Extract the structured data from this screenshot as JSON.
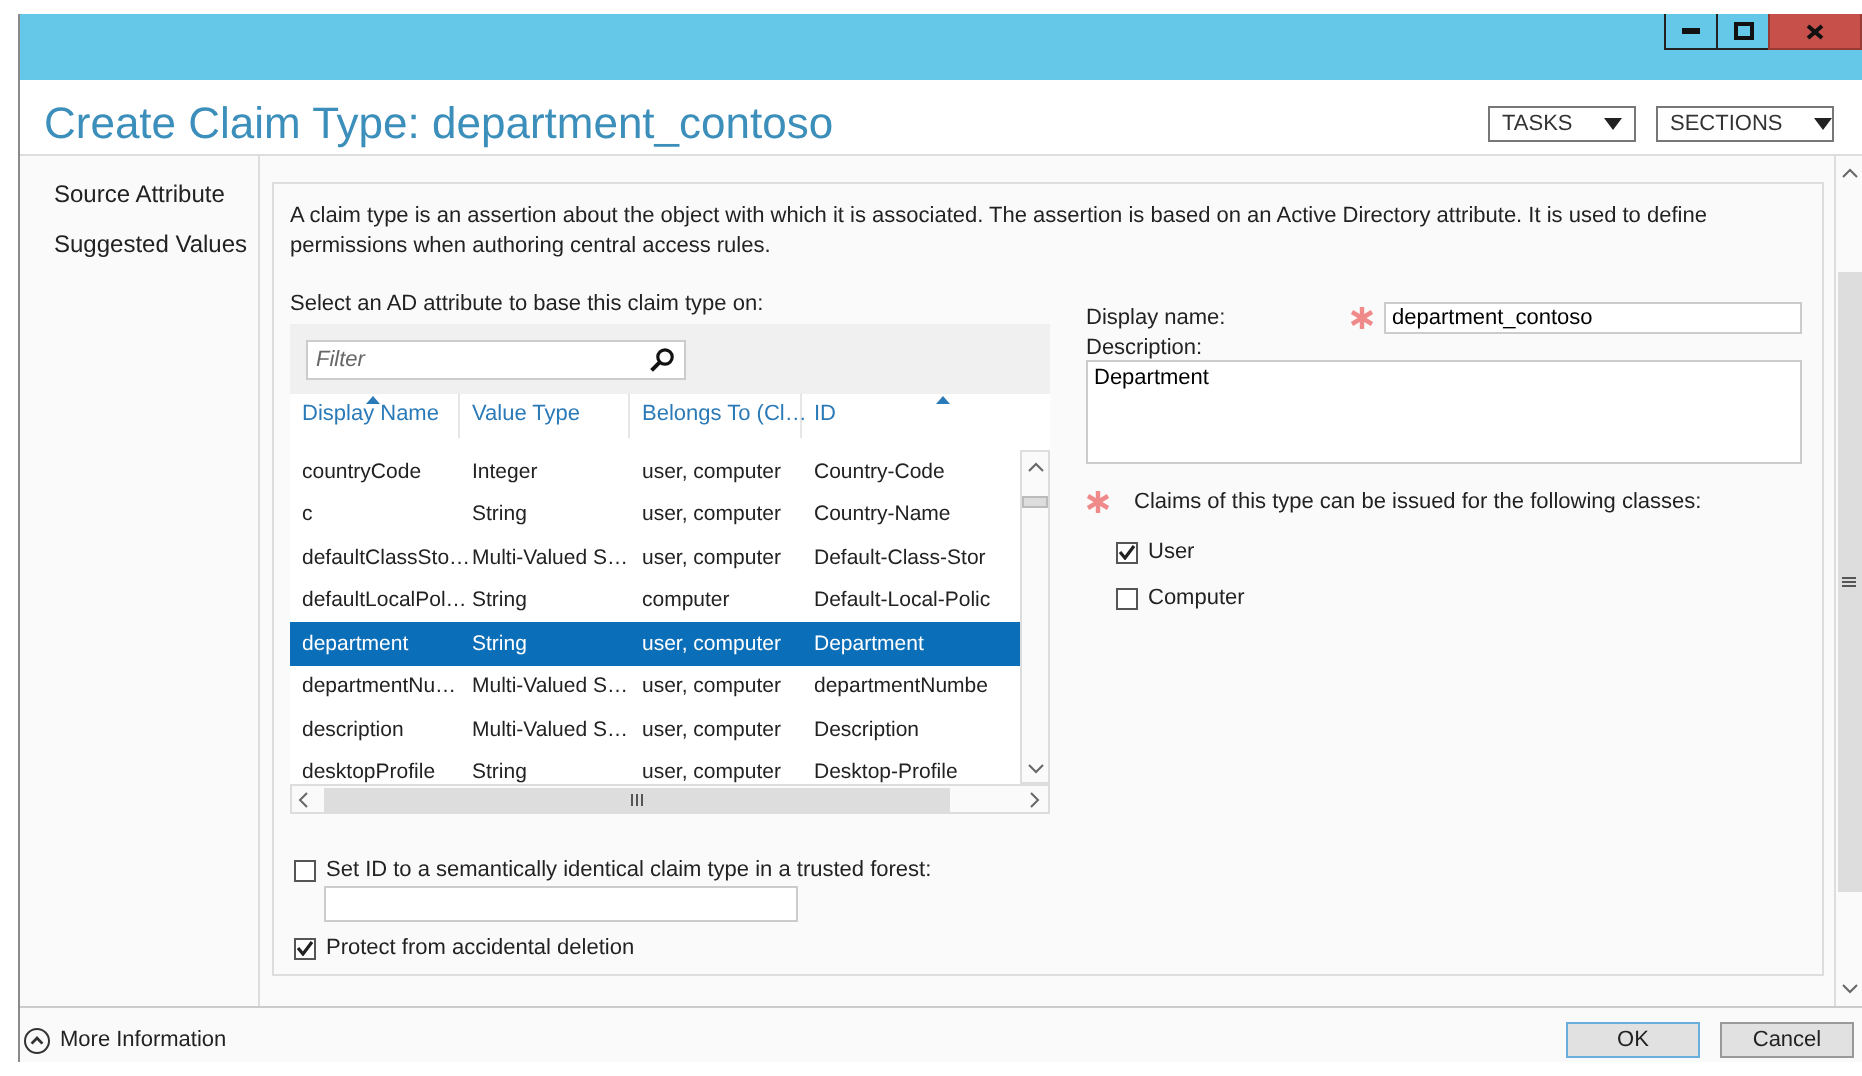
{
  "window": {
    "title": "Create Claim Type: department_contoso"
  },
  "header_menus": [
    {
      "label": "TASKS"
    },
    {
      "label": "SECTIONS"
    }
  ],
  "sidebar": {
    "items": [
      {
        "label": "Source Attribute"
      },
      {
        "label": "Suggested Values"
      }
    ]
  },
  "intro": "A claim type is an assertion about the object with which it is associated. The assertion is based on an Active Directory attribute. It is used to define permissions when authoring central access rules.",
  "attribute_picker": {
    "label": "Select an AD attribute to base this claim type on:",
    "filter": {
      "placeholder": "Filter"
    },
    "columns": [
      {
        "label": "Display Name",
        "sort_indicator": true
      },
      {
        "label": "Value Type",
        "sort_indicator": false
      },
      {
        "label": "Belongs To (Cl…",
        "sort_indicator": false
      },
      {
        "label": "ID",
        "sort_indicator": true
      }
    ],
    "rows": [
      {
        "cells": [
          "countryCode",
          "Integer",
          "user, computer",
          "Country-Code"
        ],
        "selected": false
      },
      {
        "cells": [
          "c",
          "String",
          "user, computer",
          "Country-Name"
        ],
        "selected": false
      },
      {
        "cells": [
          "defaultClassSto…",
          "Multi-Valued S…",
          "user, computer",
          "Default-Class-Stor"
        ],
        "selected": false
      },
      {
        "cells": [
          "defaultLocalPol…",
          "String",
          "computer",
          "Default-Local-Polic"
        ],
        "selected": false
      },
      {
        "cells": [
          "department",
          "String",
          "user, computer",
          "Department"
        ],
        "selected": true
      },
      {
        "cells": [
          "departmentNu…",
          "Multi-Valued S…",
          "user, computer",
          "departmentNumbe"
        ],
        "selected": false
      },
      {
        "cells": [
          "description",
          "Multi-Valued S…",
          "user, computer",
          "Description"
        ],
        "selected": false
      },
      {
        "cells": [
          "desktopProfile",
          "String",
          "user, computer",
          "Desktop-Profile"
        ],
        "selected": false
      }
    ]
  },
  "display_name": {
    "label": "Display name:",
    "required": true,
    "value": "department_contoso"
  },
  "description": {
    "label": "Description:",
    "value": "Department"
  },
  "classes": {
    "label": "Claims of this type can be issued for the following classes:",
    "required": true,
    "options": [
      {
        "label": "User",
        "checked": true
      },
      {
        "label": "Computer",
        "checked": false
      }
    ]
  },
  "set_id": {
    "label": "Set ID to a semantically identical claim type in a trusted forest:",
    "checked": false
  },
  "protect": {
    "label": "Protect from accidental deletion",
    "checked": true
  },
  "footer": {
    "more_info": "More Information",
    "buttons": [
      {
        "label": "OK",
        "default": true
      },
      {
        "label": "Cancel",
        "default": false
      }
    ]
  }
}
